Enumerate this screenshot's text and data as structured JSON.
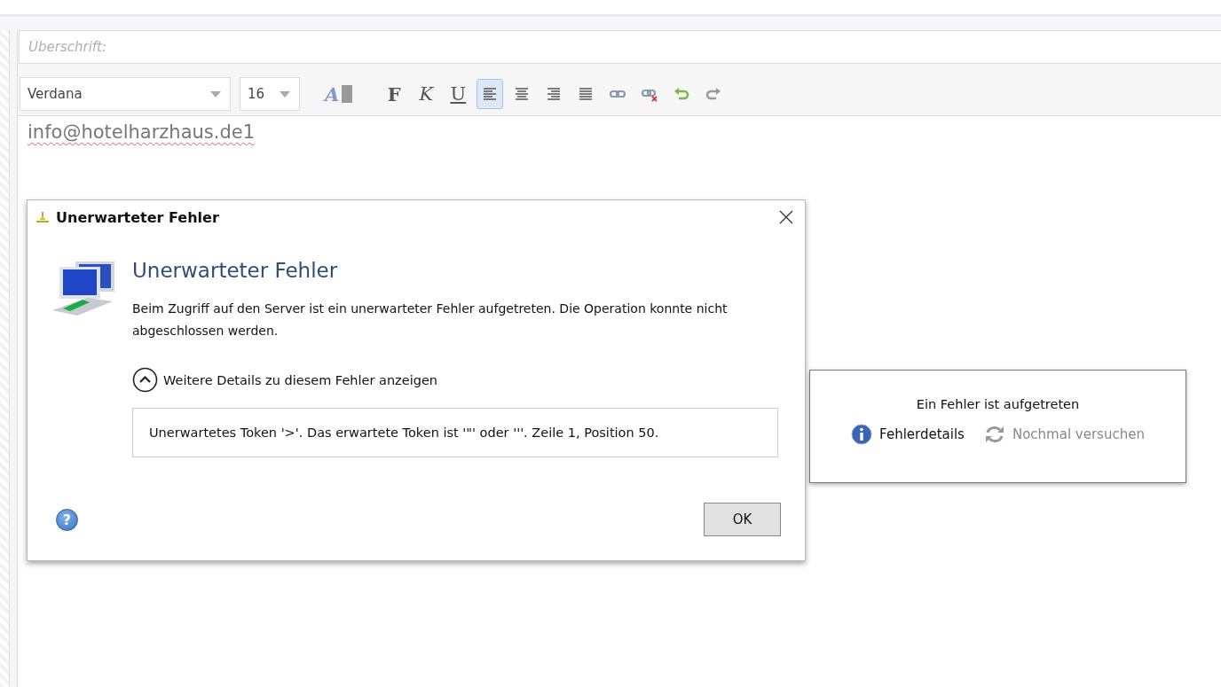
{
  "editor": {
    "subject": {
      "placeholder": "Überschrift:"
    },
    "font": {
      "value": "Verdana"
    },
    "size": {
      "value": "16"
    },
    "toolbar": [
      {
        "kind": "color",
        "label": "A"
      },
      {
        "kind": "bold",
        "label": "F"
      },
      {
        "kind": "italic",
        "label": "K"
      },
      {
        "kind": "underline",
        "label": "U"
      },
      {
        "kind": "align-left",
        "selected": true
      },
      {
        "kind": "align-center",
        "selected": false
      },
      {
        "kind": "align-right",
        "selected": false
      },
      {
        "kind": "justify",
        "selected": false
      },
      {
        "kind": "link"
      },
      {
        "kind": "unlink"
      },
      {
        "kind": "undo"
      },
      {
        "kind": "redo"
      }
    ],
    "body": "info@hotelharzhaus.de1"
  },
  "dialog": {
    "title": "Unerwarteter Fehler",
    "heading": "Unerwarteter Fehler",
    "message": "Beim Zugriff auf den Server ist ein unerwarteter Fehler aufgetreten. Die Operation konnte nicht abgeschlossen werden.",
    "details_toggle": {
      "label": "Weitere Details zu diesem Fehler anzeigen",
      "expanded": true
    },
    "details": "Unerwartetes Token '>'. Das erwartete Token ist '\"' oder '''. Zeile 1, Position 50.",
    "help": "?",
    "buttons": [
      "OK"
    ]
  },
  "notice": {
    "text": "Ein Fehler ist aufgetreten",
    "actions": [
      {
        "kind": "info",
        "label": "Fehlerdetails",
        "disabled": false
      },
      {
        "kind": "retry",
        "label": "Nochmal versuchen",
        "disabled": true
      }
    ]
  }
}
